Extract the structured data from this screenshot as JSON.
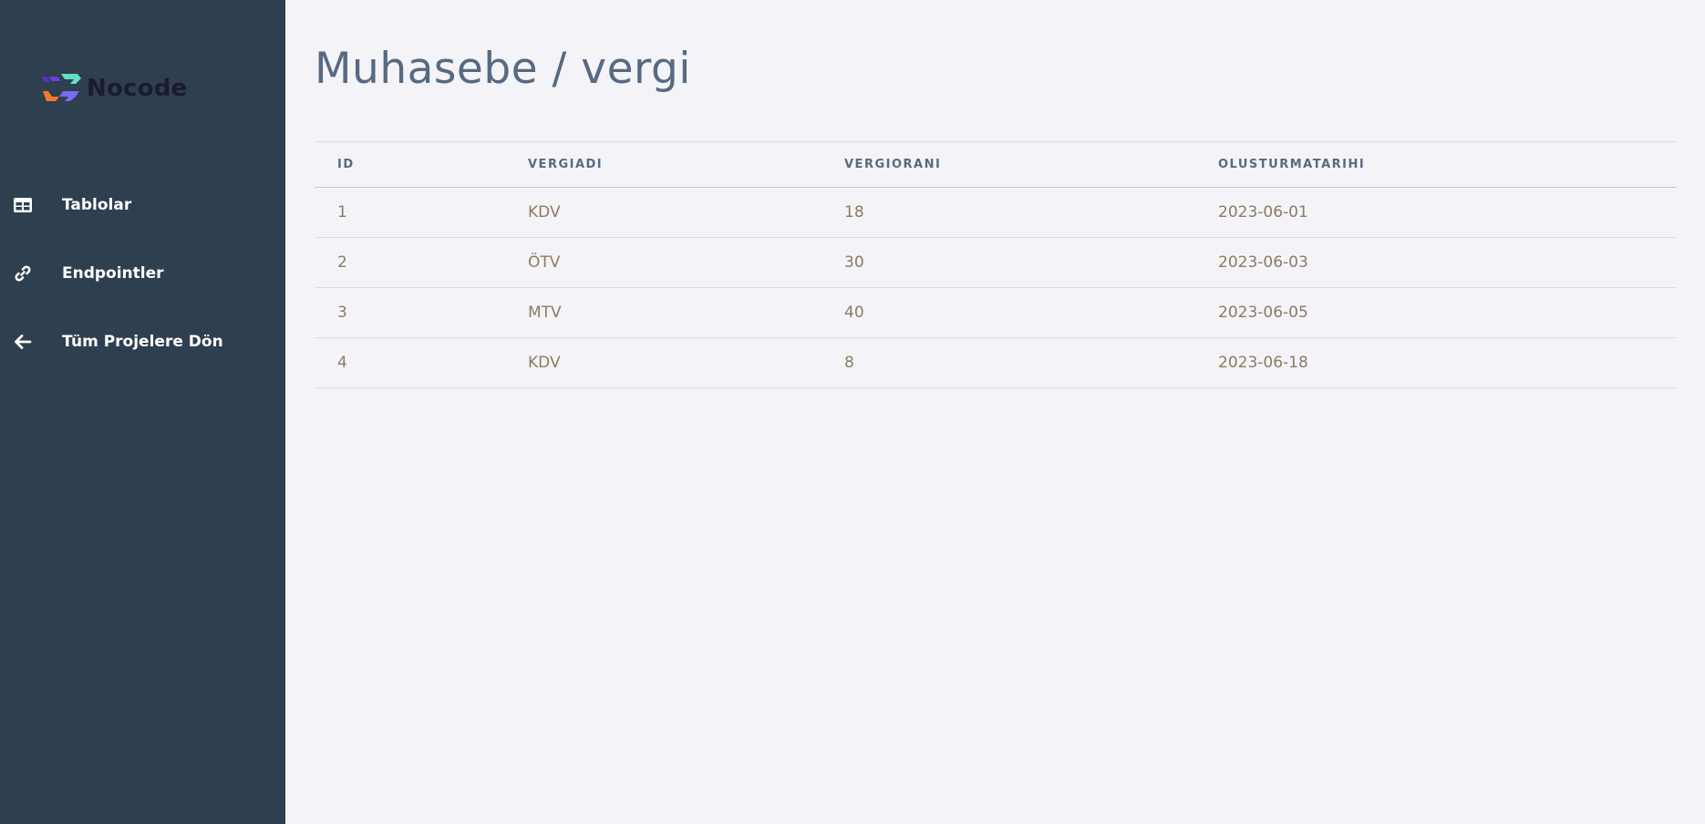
{
  "app": {
    "logo_text": "Nocode"
  },
  "sidebar": {
    "items": [
      {
        "label": "Tablolar",
        "icon": "table-icon"
      },
      {
        "label": "Endpointler",
        "icon": "link-icon"
      },
      {
        "label": "Tüm Projelere Dön",
        "icon": "arrow-left-icon"
      }
    ]
  },
  "page": {
    "title": "Muhasebe / vergi"
  },
  "table": {
    "headers": [
      "ID",
      "VERGIADI",
      "VERGIORANI",
      "OLUSTURMATARIHI"
    ],
    "rows": [
      [
        "1",
        "KDV",
        "18",
        "2023-06-01"
      ],
      [
        "2",
        "ÖTV",
        "30",
        "2023-06-03"
      ],
      [
        "3",
        "MTV",
        "40",
        "2023-06-05"
      ],
      [
        "4",
        "KDV",
        "8",
        "2023-06-18"
      ]
    ]
  },
  "colors": {
    "sidebar_bg": "#2e3f4f",
    "main_bg": "#f4f4f8",
    "title": "#566a82",
    "cell_text": "#8a7b62"
  }
}
